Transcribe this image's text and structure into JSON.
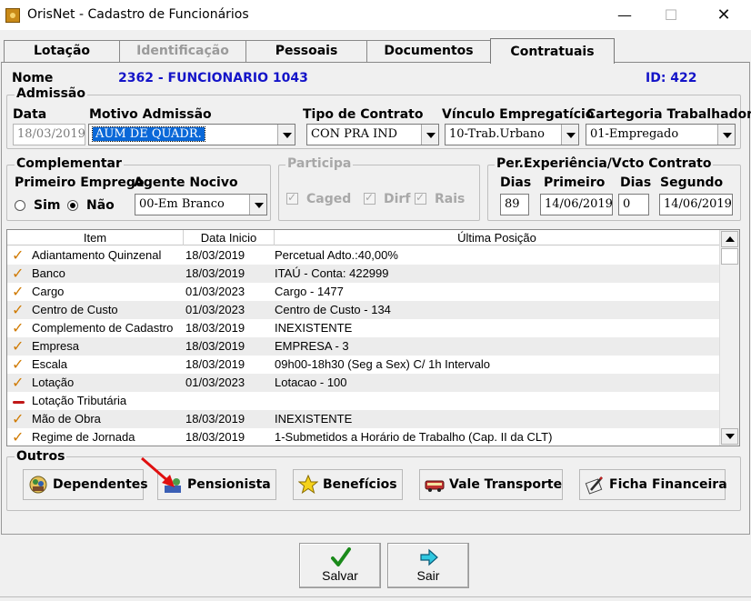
{
  "window": {
    "title": "OrisNet - Cadastro de Funcionários",
    "min_glyph": "—",
    "max_glyph": "☐",
    "close_glyph": "✕"
  },
  "tabs": [
    {
      "label": "Lotação",
      "state": "normal"
    },
    {
      "label": "Identificação",
      "state": "disabled"
    },
    {
      "label": "Pessoais",
      "state": "normal"
    },
    {
      "label": "Documentos",
      "state": "normal"
    },
    {
      "label": "Contratuais",
      "state": "active"
    }
  ],
  "header": {
    "nome_label": "Nome",
    "nome_value": "2362 - FUNCIONARIO 1043",
    "id_label": "ID: 422"
  },
  "admissao": {
    "title": "Admissão",
    "data_label": "Data",
    "data_value": "18/03/2019",
    "motivo_label": "Motivo Admissão",
    "motivo_value": "AUM DE QUADR.",
    "tipo_label": "Tipo de Contrato",
    "tipo_value": "CON PRA IND",
    "vinculo_label": "Vínculo Empregatício",
    "vinculo_value": "10-Trab.Urbano",
    "categoria_label": "Cartegoria Trabalhador",
    "categoria_value": "01-Empregado"
  },
  "complementar": {
    "title": "Complementar",
    "primeiro_emprego_label": "Primeiro Emprego",
    "sim_label": "Sim",
    "nao_label": "Não",
    "selected": "nao",
    "agente_label": "Agente Nocivo",
    "agente_value": "00-Em Branco"
  },
  "participa": {
    "title": "Participa",
    "caged_label": "Caged",
    "dirf_label": "Dirf",
    "rais_label": "Rais"
  },
  "experiencia": {
    "title": "Per.Experiência/Vcto Contrato",
    "dias_label": "Dias",
    "primeiro_label": "Primeiro",
    "dias2_label": "Dias",
    "segundo_label": "Segundo",
    "dias_value": "89",
    "primeiro_value": "14/06/2019",
    "dias2_value": "0",
    "segundo_value": "14/06/2019"
  },
  "grid": {
    "columns": [
      "Item",
      "Data Inicio",
      "Última Posição"
    ],
    "rows": [
      {
        "mark": "check",
        "item": "Adiantamento Quinzenal",
        "data": "18/03/2019",
        "posicao": "Percetual Adto.:40,00%"
      },
      {
        "mark": "check",
        "item": "Banco",
        "data": "18/03/2019",
        "posicao": "ITAÚ - Conta: 422999"
      },
      {
        "mark": "check",
        "item": "Cargo",
        "data": "01/03/2023",
        "posicao": "Cargo - 1477"
      },
      {
        "mark": "check",
        "item": "Centro de Custo",
        "data": "01/03/2023",
        "posicao": "Centro de Custo - 134"
      },
      {
        "mark": "check",
        "item": "Complemento de Cadastro",
        "data": "18/03/2019",
        "posicao": "INEXISTENTE"
      },
      {
        "mark": "check",
        "item": "Empresa",
        "data": "18/03/2019",
        "posicao": "EMPRESA - 3"
      },
      {
        "mark": "check",
        "item": "Escala",
        "data": "18/03/2019",
        "posicao": "09h00-18h30 (Seg a Sex) C/ 1h Intervalo"
      },
      {
        "mark": "check",
        "item": "Lotação",
        "data": "01/03/2023",
        "posicao": "Lotacao - 100"
      },
      {
        "mark": "dash",
        "item": "Lotação Tributária",
        "data": "",
        "posicao": ""
      },
      {
        "mark": "check",
        "item": "Mão de Obra",
        "data": "18/03/2019",
        "posicao": "INEXISTENTE"
      },
      {
        "mark": "check",
        "item": "Regime de Jornada",
        "data": "18/03/2019",
        "posicao": "1-Submetidos a Horário de Trabalho (Cap. II da CLT)"
      }
    ]
  },
  "outros": {
    "title": "Outros",
    "buttons": [
      {
        "label": "Dependentes",
        "icon": "family-icon"
      },
      {
        "label": "Pensionista",
        "icon": "people-icon"
      },
      {
        "label": "Benefícios",
        "icon": "star-icon"
      },
      {
        "label": "Vale Transporte",
        "icon": "bus-icon"
      },
      {
        "label": "Ficha Financeira",
        "icon": "paper-pen-icon"
      }
    ]
  },
  "actions": {
    "salvar": "Salvar",
    "sair": "Sair"
  },
  "colors": {
    "accent_blue": "#1414c8",
    "selection": "#0a68d8",
    "check_orange": "#d07a00",
    "annotation_red": "#e01010"
  }
}
